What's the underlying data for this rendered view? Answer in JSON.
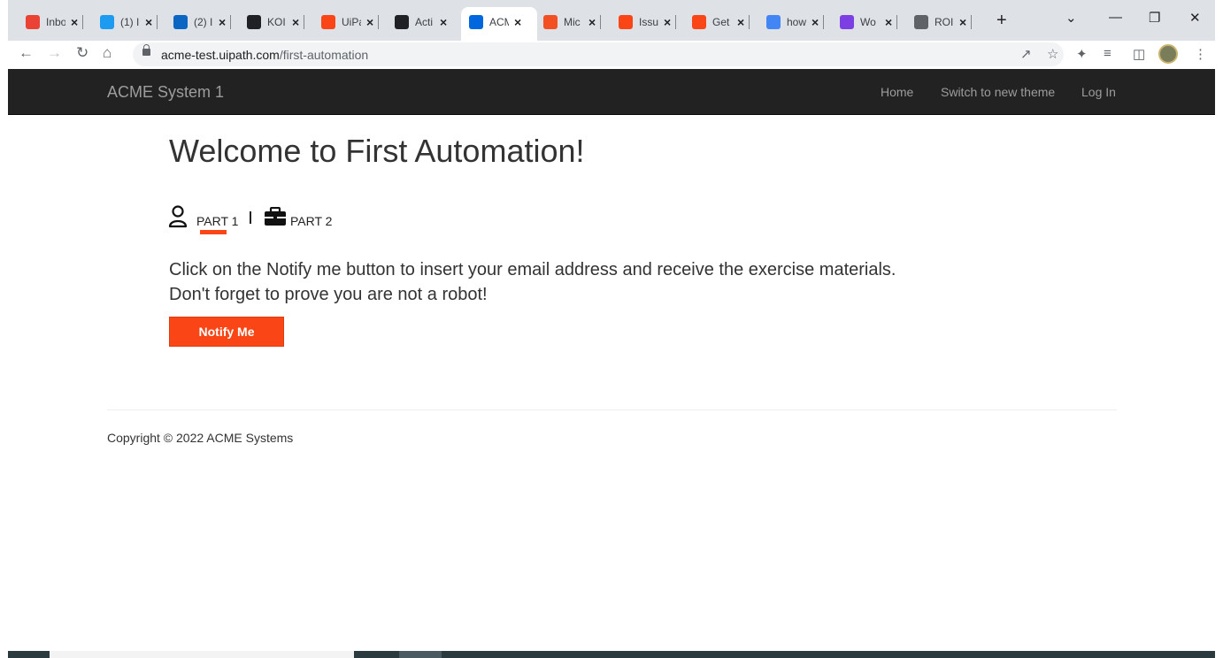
{
  "browser": {
    "tabs": [
      {
        "title": "Inbo",
        "icon": "gmail-icon",
        "color": "#ea4335"
      },
      {
        "title": "(1) I",
        "icon": "twitter-icon",
        "color": "#1d9bf0"
      },
      {
        "title": "(2) I",
        "icon": "linkedin-icon",
        "color": "#0a66c2"
      },
      {
        "title": "KOI",
        "icon": "edit-icon",
        "color": "#202124"
      },
      {
        "title": "UiPa",
        "icon": "uipath-icon",
        "color": "#fa4616"
      },
      {
        "title": "Acti",
        "icon": "github-icon",
        "color": "#202124"
      },
      {
        "title": "ACM",
        "icon": "uipath-icon",
        "color": "#0067df"
      },
      {
        "title": "Mic",
        "icon": "microsoft-icon",
        "color": "#f25022"
      },
      {
        "title": "Issu",
        "icon": "uipath-icon",
        "color": "#fa4616"
      },
      {
        "title": "Get",
        "icon": "uipath-icon",
        "color": "#fa4616"
      },
      {
        "title": "how",
        "icon": "google-icon",
        "color": "#4285f4"
      },
      {
        "title": "Wo",
        "icon": "windows-icon",
        "color": "#7b3fe4"
      },
      {
        "title": "ROI",
        "icon": "globe-icon",
        "color": "#5f6368"
      }
    ],
    "url_domain": "acme-test.uipath.com",
    "url_path": "/first-automation"
  },
  "site": {
    "brand": "ACME System 1",
    "nav": {
      "home": "Home",
      "switch_theme": "Switch to new theme",
      "login": "Log In"
    }
  },
  "page": {
    "title": "Welcome to First Automation!",
    "part1_label": "PART 1",
    "part2_label": "PART 2",
    "description_line1": "Click on the Notify me button to insert your email address and receive the exercise materials.",
    "description_line2": "Don't forget to prove you are not a robot!",
    "notify_button": "Notify Me",
    "copyright": "Copyright © 2022 ACME Systems"
  },
  "colors": {
    "accent": "#fa4616",
    "navbar_bg": "#222222",
    "navbar_text": "#9d9d9d"
  }
}
